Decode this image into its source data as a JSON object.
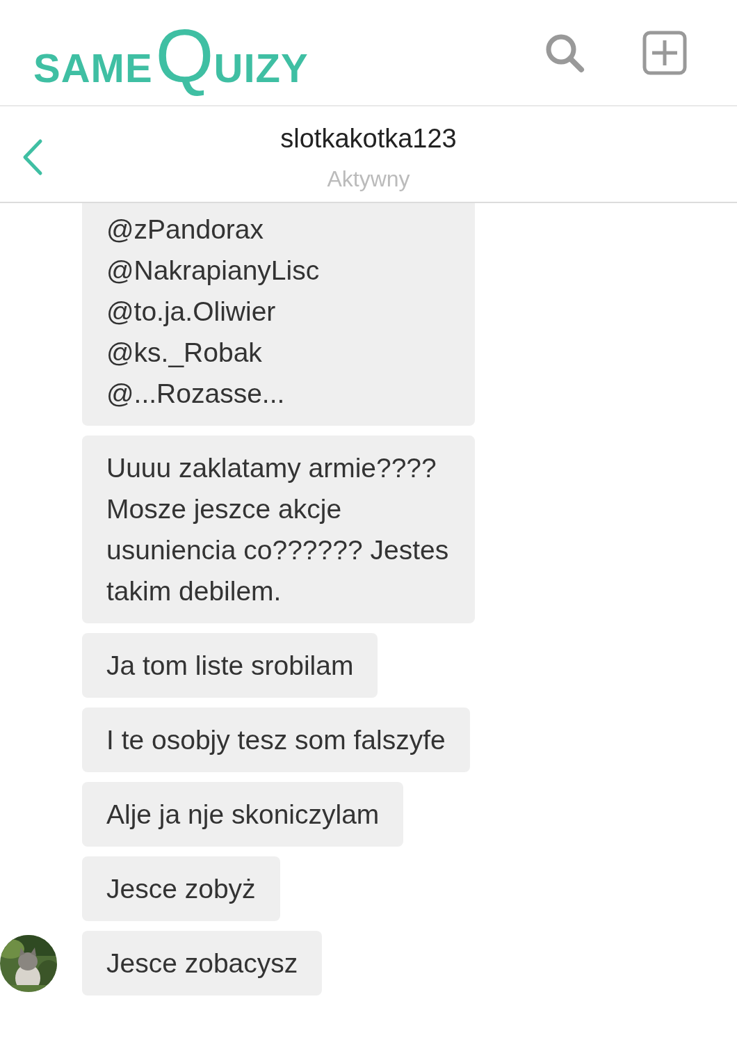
{
  "logo": {
    "first": "SAME",
    "initial": "Q",
    "rest": "UIZY"
  },
  "chat_header": {
    "username": "slotkakotka123",
    "status": "Aktywny"
  },
  "messages": [
    {
      "text": "@zPandorax\n@NakrapianyLisc\n@to.ja.Oliwier\n@ks._Robak\n@...Rozasse...",
      "cut_top": true,
      "avatar": false
    },
    {
      "text": "Uuuu zaklatamy armie???? Mosze jeszce akcje usuniencia co?????? Jestes takim debilem.",
      "cut_top": false,
      "avatar": false
    },
    {
      "text": "Ja tom liste srobilam",
      "cut_top": false,
      "avatar": false
    },
    {
      "text": "I te osobjy tesz som falszyfe",
      "cut_top": false,
      "avatar": false
    },
    {
      "text": "Alje ja nje skoniczylam",
      "cut_top": false,
      "avatar": false
    },
    {
      "text": "Jesce zobyż",
      "cut_top": false,
      "avatar": false
    },
    {
      "text": "Jesce zobacysz",
      "cut_top": false,
      "avatar": true
    }
  ]
}
